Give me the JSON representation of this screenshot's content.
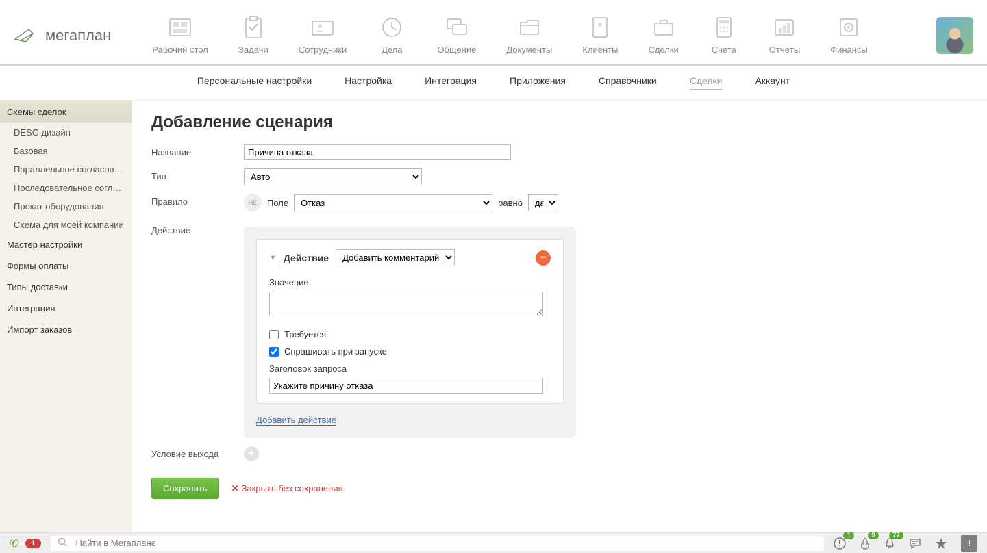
{
  "logo": "мегаплан",
  "nav": [
    {
      "label": "Рабочий стол"
    },
    {
      "label": "Задачи"
    },
    {
      "label": "Сотрудники"
    },
    {
      "label": "Дела"
    },
    {
      "label": "Общение"
    },
    {
      "label": "Документы"
    },
    {
      "label": "Клиенты"
    },
    {
      "label": "Сделки"
    },
    {
      "label": "Счета"
    },
    {
      "label": "Отчёты"
    },
    {
      "label": "Финансы"
    }
  ],
  "subnav": [
    {
      "label": "Персональные настройки"
    },
    {
      "label": "Настройка"
    },
    {
      "label": "Интеграция"
    },
    {
      "label": "Приложения"
    },
    {
      "label": "Справочники"
    },
    {
      "label": "Сделки",
      "active": true
    },
    {
      "label": "Аккаунт"
    }
  ],
  "sidebar": {
    "schemes_label": "Схемы сделок",
    "schemes": [
      "DESC-дизайн",
      "Базовая",
      "Параллельное согласование",
      "Последовательное согласов...",
      "Прокат оборудования",
      "Схема для моей компании"
    ],
    "items": [
      "Мастер настройки",
      "Формы оплаты",
      "Типы доставки",
      "Интеграция",
      "Импорт заказов"
    ]
  },
  "page": {
    "title": "Добавление сценария",
    "name_label": "Название",
    "name_value": "Причина отказа",
    "type_label": "Тип",
    "type_value": "Авто",
    "rule_label": "Правило",
    "not_label": "НЕ",
    "field_label": "Поле",
    "field_select": "Отказ",
    "equals_label": "равно",
    "equals_value": "да",
    "action_label": "Действие",
    "card": {
      "title": "Действие",
      "select": "Добавить комментарий",
      "value_label": "Значение",
      "required_label": "Требуется",
      "ask_label": "Спрашивать при запуске",
      "prompt_label": "Заголовок запроса",
      "prompt_value": "Укажите причину отказа"
    },
    "add_action": "Добавить действие",
    "exit_label": "Условие выхода",
    "save": "Сохранить",
    "cancel": "Закрыть без сохранения"
  },
  "bottom": {
    "phone_badge": "1",
    "search_placeholder": "Найти в Мегаплане",
    "n1": "1",
    "n2": "9",
    "n3": "77"
  }
}
